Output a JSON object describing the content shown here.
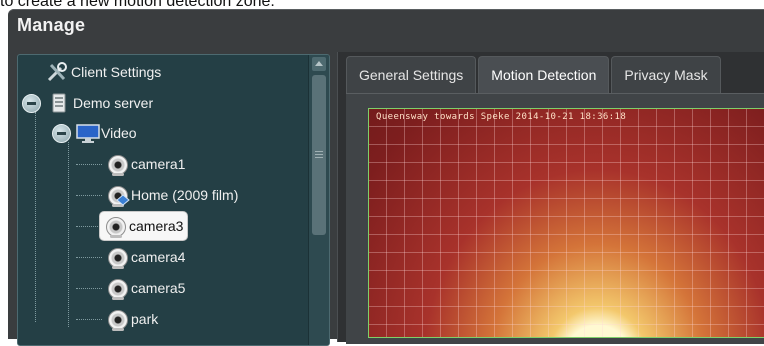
{
  "caption": "to create a new motion detection zone.",
  "window": {
    "title": "Manage"
  },
  "tree": {
    "nodes": [
      {
        "label": "Client Settings",
        "icon": "tools-icon"
      },
      {
        "label": "Demo server",
        "icon": "server-icon"
      },
      {
        "label": "Video",
        "icon": "monitor-icon"
      },
      {
        "label": "camera1",
        "icon": "camera-icon"
      },
      {
        "label": "Home (2009 film)",
        "icon": "ptz-camera-icon"
      },
      {
        "label": "camera3",
        "icon": "camera-icon",
        "selected": true
      },
      {
        "label": "camera4",
        "icon": "camera-icon"
      },
      {
        "label": "camera5",
        "icon": "camera-icon"
      },
      {
        "label": "park",
        "icon": "camera-icon"
      }
    ]
  },
  "tabs": [
    {
      "label": "General Settings"
    },
    {
      "label": "Motion Detection",
      "active": true
    },
    {
      "label": "Privacy Mask"
    }
  ],
  "video": {
    "overlay_text": "Queensway towards Speke 2014-10-21 18:36:18"
  },
  "colors": {
    "window_bg": "#3a3d3f",
    "tree_bg": "#243f45",
    "selection_bg": "#f7f7f7",
    "grid_line": "#ffd7d7",
    "zone_border": "#7fd06a"
  }
}
